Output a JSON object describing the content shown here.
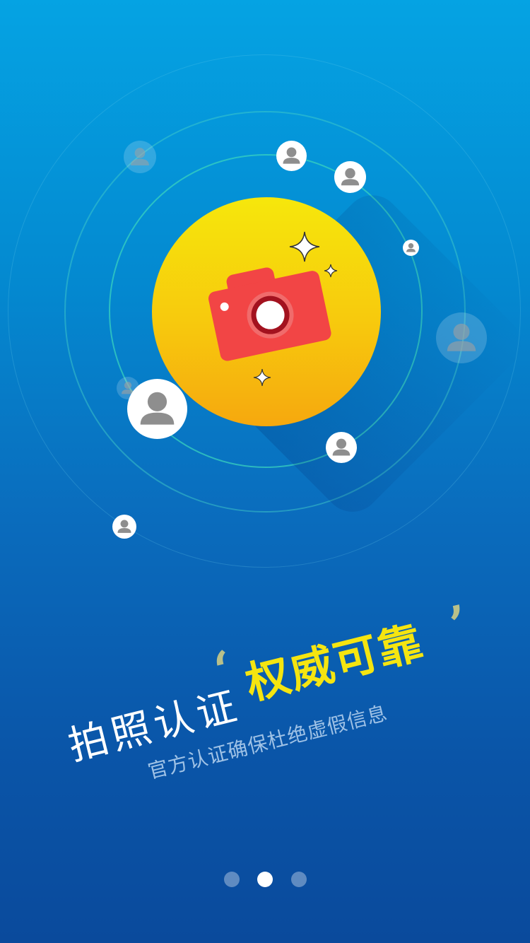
{
  "onboarding": {
    "title_main": "拍照认证",
    "quote_open": "‘",
    "title_highlight": "权威可靠",
    "quote_close": "’",
    "subtitle": "官方认证确保杜绝虚假信息"
  },
  "illustration": {
    "center_icon": "camera-icon",
    "orbit_icon": "user-avatar-icon",
    "sparkle_icon": "sparkle-icon"
  },
  "pager": {
    "total_pages": 3,
    "current_page": 2
  },
  "colors": {
    "background_top": "#05a3e3",
    "background_bottom": "#0a4a9c",
    "sun_yellow": "#f6e70c",
    "sun_orange": "#f6a80e",
    "camera_red": "#f24545",
    "highlight_yellow": "#f5e510",
    "avatar_grey": "#8e8e8e"
  }
}
